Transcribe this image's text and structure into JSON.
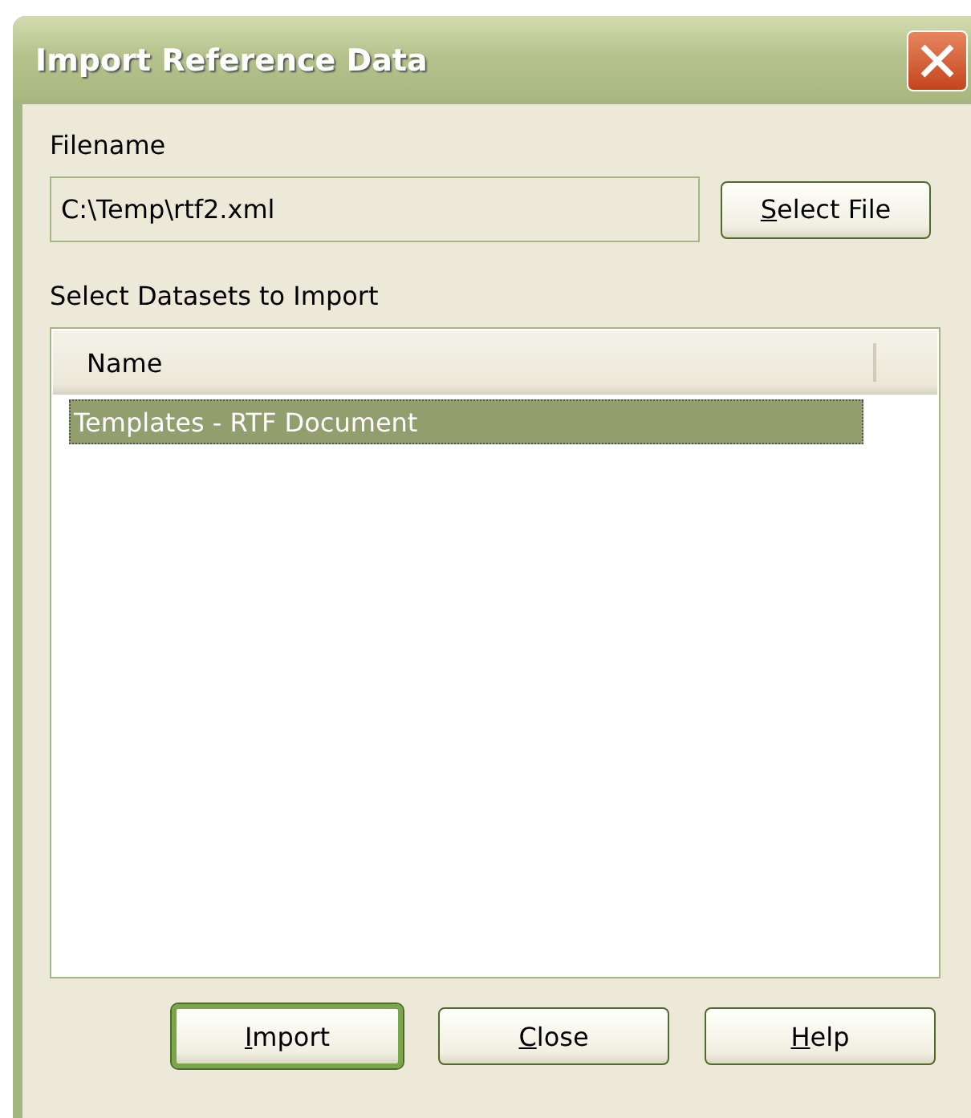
{
  "window": {
    "title": "Import Reference Data"
  },
  "filename": {
    "label": "Filename",
    "value": "C:\\Temp\\rtf2.xml",
    "button": {
      "key": "S",
      "rest": "elect File"
    }
  },
  "datasets": {
    "label": "Select Datasets to Import",
    "columns": [
      "Name"
    ],
    "rows": [
      {
        "name": "Templates - RTF Document",
        "selected": true
      }
    ]
  },
  "buttons": [
    {
      "key": "I",
      "rest": "mport",
      "default": true
    },
    {
      "key": "C",
      "rest": "lose",
      "default": false
    },
    {
      "key": "H",
      "rest": "elp",
      "default": false
    }
  ]
}
